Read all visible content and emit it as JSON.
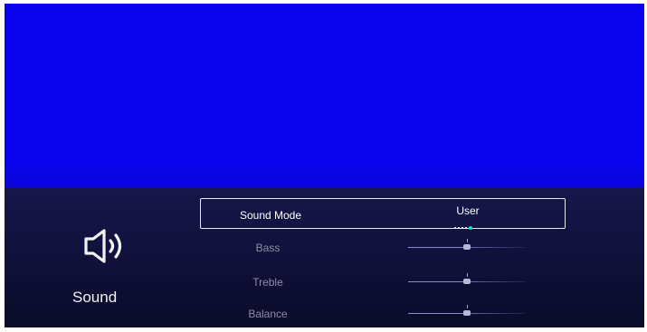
{
  "category": {
    "label": "Sound",
    "icon": "speaker-icon"
  },
  "sound_mode": {
    "label": "Sound Mode",
    "value": "User",
    "option_count": 5,
    "selected_option_index": 4
  },
  "sliders": [
    {
      "label": "Bass",
      "level": 0.5
    },
    {
      "label": "Treble",
      "level": 0.5
    },
    {
      "label": "Balance",
      "level": 0.5
    }
  ],
  "colors": {
    "video_background": "#0a04ee",
    "menu_background": "#13143f",
    "accent": "#2fd0c6",
    "text_primary": "#ffffff",
    "text_secondary": "#8c8ca6"
  }
}
